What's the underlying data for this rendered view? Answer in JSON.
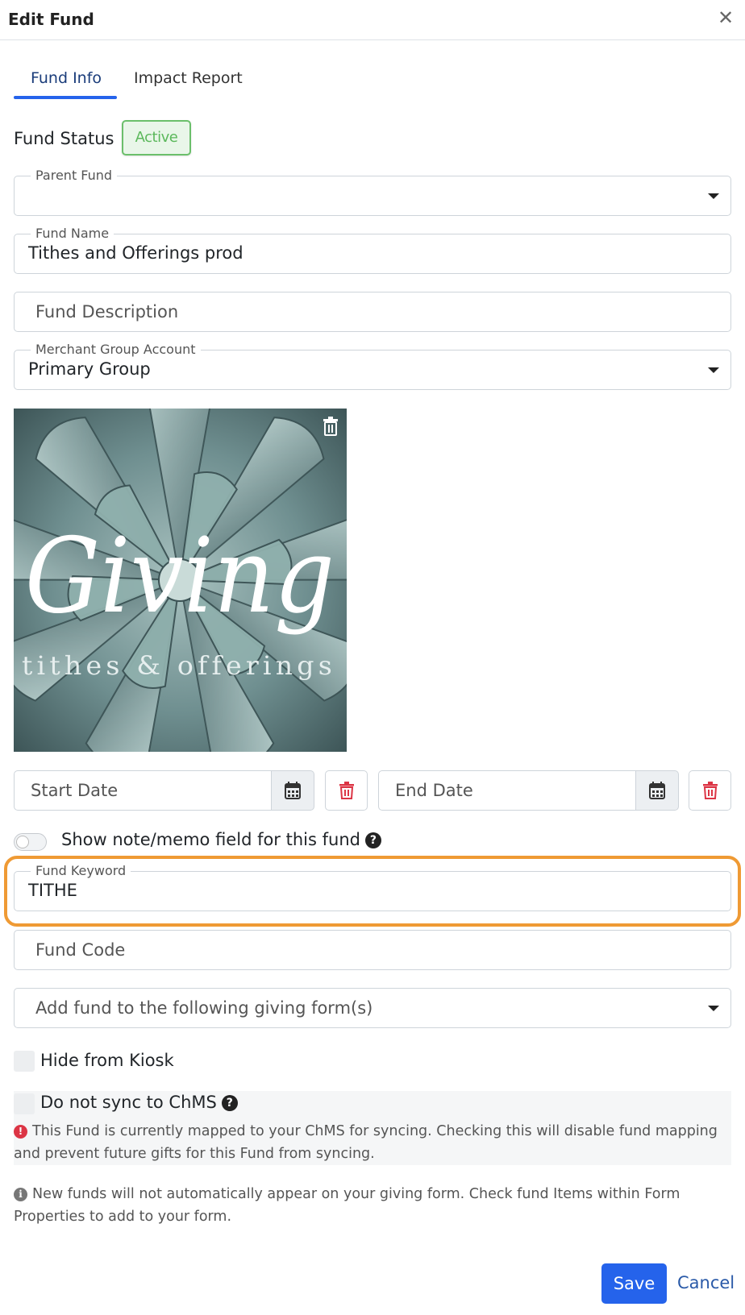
{
  "header": {
    "title": "Edit Fund",
    "close_icon": "close-icon"
  },
  "tabs": [
    {
      "label": "Fund Info",
      "active": true
    },
    {
      "label": "Impact Report",
      "active": false
    }
  ],
  "fund_status": {
    "label": "Fund Status",
    "value": "Active",
    "color": "#5cb85c"
  },
  "parent_fund": {
    "legend": "Parent Fund",
    "value": ""
  },
  "fund_name": {
    "legend": "Fund Name",
    "value": "Tithes and Offerings prod"
  },
  "fund_description": {
    "placeholder": "Fund Description",
    "value": ""
  },
  "merchant_group": {
    "legend": "Merchant Group Account",
    "value": "Primary Group"
  },
  "image": {
    "title_text": "Giving",
    "subtitle_text": "tithes & offerings",
    "delete_icon": "trash-icon"
  },
  "start_date": {
    "placeholder": "Start Date",
    "icon": "calendar-icon",
    "delete_icon": "trash-icon"
  },
  "end_date": {
    "placeholder": "End Date",
    "icon": "calendar-icon",
    "delete_icon": "trash-icon"
  },
  "memo_toggle": {
    "label": "Show note/memo field for this fund",
    "on": false,
    "help_icon": "question-circle-icon"
  },
  "fund_keyword": {
    "legend": "Fund Keyword",
    "value": "TITHE"
  },
  "fund_code": {
    "placeholder": "Fund Code",
    "value": ""
  },
  "giving_forms": {
    "placeholder": "Add fund to the following giving form(s)"
  },
  "hide_kiosk": {
    "label": "Hide from Kiosk",
    "checked": false
  },
  "no_sync": {
    "label": "Do not sync to ChMS",
    "checked": false,
    "warning": "This Fund is currently mapped to your ChMS for syncing. Checking this will disable fund mapping and prevent future gifts for this Fund from syncing."
  },
  "info_note": "New funds will not automatically appear on your giving form. Check fund Items within Form Properties to add to your form.",
  "actions": {
    "save_label": "Save",
    "cancel_label": "Cancel"
  },
  "colors": {
    "primary": "#2563eb",
    "highlight": "#ef9a34",
    "danger": "#dc3545"
  }
}
